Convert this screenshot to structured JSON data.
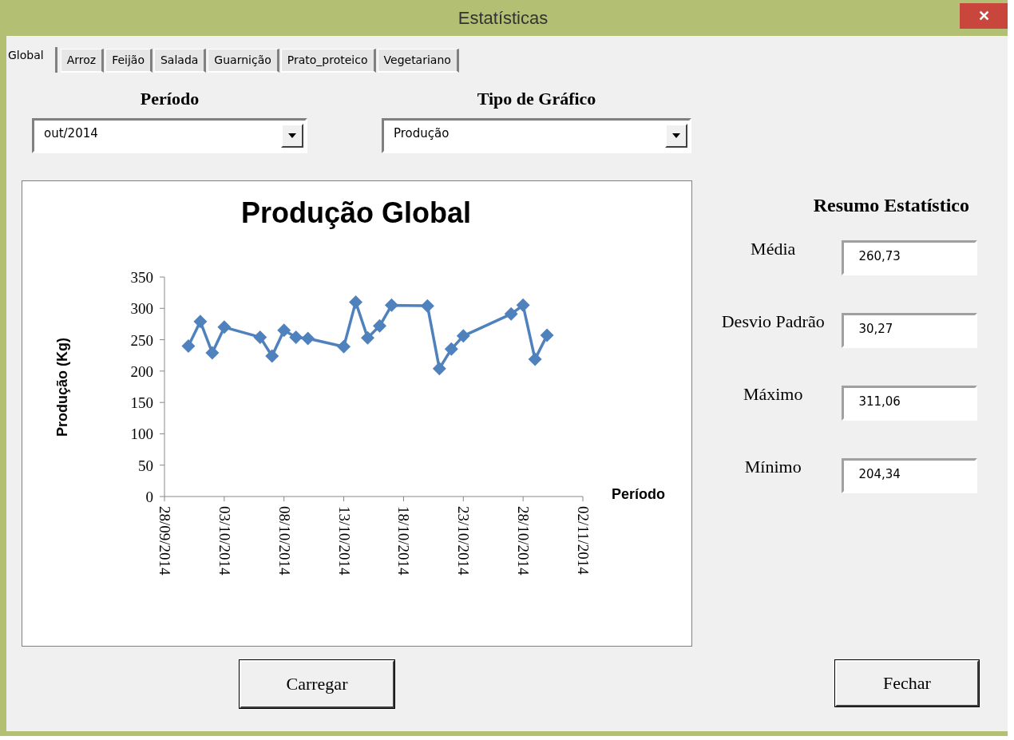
{
  "window": {
    "title": "Estatísticas",
    "close": "✕"
  },
  "tabs": [
    {
      "label": "Global",
      "selected": true
    },
    {
      "label": "Arroz",
      "selected": false
    },
    {
      "label": "Feijão",
      "selected": false
    },
    {
      "label": "Salada",
      "selected": false
    },
    {
      "label": "Guarnição",
      "selected": false
    },
    {
      "label": "Prato_proteico",
      "selected": false
    },
    {
      "label": "Vegetariano",
      "selected": false
    }
  ],
  "periodo": {
    "label": "Período",
    "value": "out/2014"
  },
  "tipo": {
    "label": "Tipo de Gráfico",
    "value": "Produção"
  },
  "chart": {
    "chart_data": {
      "type": "line",
      "title": "Produção Global",
      "xlabel": "Período",
      "ylabel": "Produção (Kg)",
      "categories": [
        "28/09/2014",
        null,
        null,
        null,
        null,
        "03/10/2014",
        null,
        null,
        null,
        null,
        "08/10/2014",
        null,
        null,
        null,
        null,
        "13/10/2014",
        null,
        null,
        null,
        null,
        "18/10/2014",
        null,
        null,
        null,
        null,
        "23/10/2014",
        null,
        null,
        null,
        null,
        "28/10/2014",
        null,
        null,
        null,
        null,
        "02/11/2014"
      ],
      "series": [
        {
          "color": "#4f81bd",
          "marker": "diamond",
          "values": [
            null,
            null,
            240,
            279,
            229,
            270,
            null,
            null,
            254,
            224,
            265,
            254,
            252,
            null,
            null,
            239,
            310,
            253,
            272,
            305,
            null,
            null,
            304,
            204,
            235,
            256,
            null,
            null,
            null,
            291,
            305,
            219,
            257,
            null,
            null,
            null
          ]
        }
      ],
      "ylim": [
        0,
        350
      ],
      "yticks": [
        0,
        50,
        100,
        150,
        200,
        250,
        300,
        350
      ]
    }
  },
  "summary": {
    "title": "Resumo Estatístico",
    "rows": [
      {
        "label": "Média",
        "value": "260,73"
      },
      {
        "label": "Desvio Padrão",
        "value": "30,27"
      },
      {
        "label": "Máximo",
        "value": "311,06"
      },
      {
        "label": "Mínimo",
        "value": "204,34"
      }
    ]
  },
  "buttons": {
    "load": "Carregar",
    "close": "Fechar"
  }
}
